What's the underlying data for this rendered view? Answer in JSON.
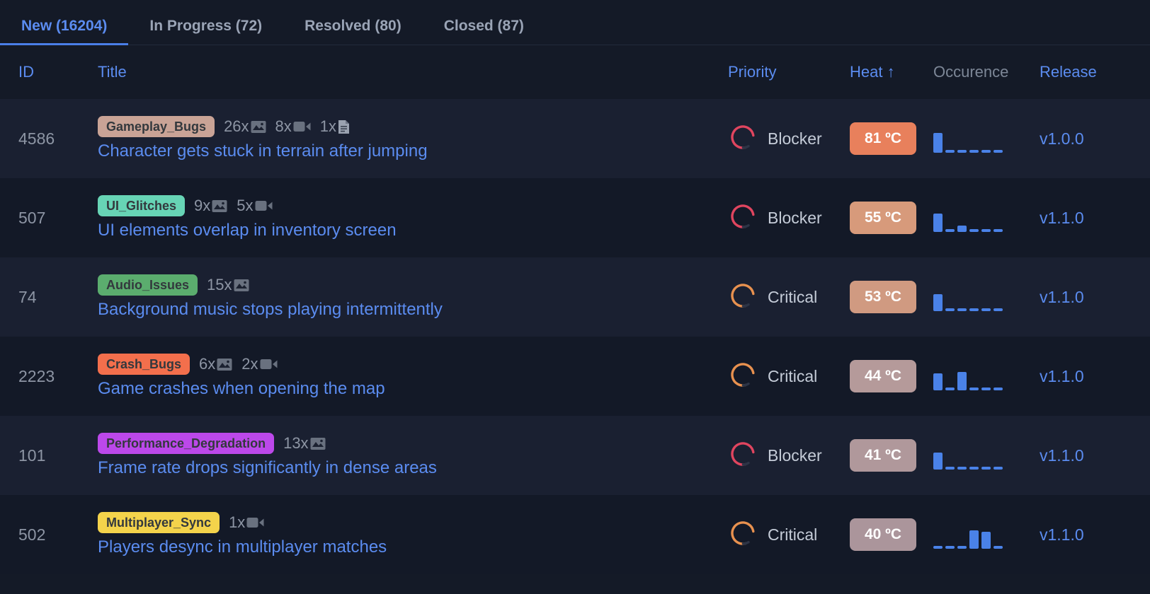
{
  "tabs": [
    {
      "label": "New (16204)",
      "active": true
    },
    {
      "label": "In Progress (72)",
      "active": false
    },
    {
      "label": "Resolved (80)",
      "active": false
    },
    {
      "label": "Closed (87)",
      "active": false
    }
  ],
  "columns": {
    "id": "ID",
    "title": "Title",
    "priority": "Priority",
    "heat": "Heat ↑",
    "occurence": "Occurence",
    "release": "Release"
  },
  "accent_color": "#5b8cf0",
  "rows": [
    {
      "id": "4586",
      "tag": "Gameplay_Bugs",
      "tag_color": "#c9a396",
      "attachments": [
        {
          "count": "26x",
          "icon": "image-icon"
        },
        {
          "count": "8x",
          "icon": "video-icon"
        },
        {
          "count": "1x",
          "icon": "document-icon"
        }
      ],
      "title": "Character gets stuck in terrain after jumping",
      "priority": "Blocker",
      "priority_color": "#e0455f",
      "heat": "81 ºC",
      "heat_color": "#e8805c",
      "occurence": [
        28,
        4,
        4,
        4,
        4,
        4
      ],
      "release": "v1.0.0"
    },
    {
      "id": "507",
      "tag": "UI_Glitches",
      "tag_color": "#67d4b5",
      "attachments": [
        {
          "count": "9x",
          "icon": "image-icon"
        },
        {
          "count": "5x",
          "icon": "video-icon"
        }
      ],
      "title": "UI elements overlap in inventory screen",
      "priority": "Blocker",
      "priority_color": "#e0455f",
      "heat": "55 ºC",
      "heat_color": "#d79a7b",
      "occurence": [
        26,
        4,
        9,
        4,
        4,
        4
      ],
      "release": "v1.1.0"
    },
    {
      "id": "74",
      "tag": "Audio_Issues",
      "tag_color": "#5bad6e",
      "attachments": [
        {
          "count": "15x",
          "icon": "image-icon"
        }
      ],
      "title": "Background music stops playing intermittently",
      "priority": "Critical",
      "priority_color": "#e8914f",
      "heat": "53 ºC",
      "heat_color": "#d09a81",
      "occurence": [
        24,
        4,
        4,
        4,
        4,
        4
      ],
      "release": "v1.1.0"
    },
    {
      "id": "2223",
      "tag": "Crash_Bugs",
      "tag_color": "#f36f4c",
      "attachments": [
        {
          "count": "6x",
          "icon": "image-icon"
        },
        {
          "count": "2x",
          "icon": "video-icon"
        }
      ],
      "title": "Game crashes when opening the map",
      "priority": "Critical",
      "priority_color": "#e8914f",
      "heat": "44 ºC",
      "heat_color": "#b59a9a",
      "occurence": [
        24,
        4,
        26,
        4,
        4,
        4
      ],
      "release": "v1.1.0"
    },
    {
      "id": "101",
      "tag": "Performance_Degradation",
      "tag_color": "#bc48ea",
      "attachments": [
        {
          "count": "13x",
          "icon": "image-icon"
        }
      ],
      "title": "Frame rate drops significantly in dense areas",
      "priority": "Blocker",
      "priority_color": "#e0455f",
      "heat": "41 ºC",
      "heat_color": "#b0989b",
      "occurence": [
        24,
        4,
        4,
        4,
        4,
        4
      ],
      "release": "v1.1.0"
    },
    {
      "id": "502",
      "tag": "Multiplayer_Sync",
      "tag_color": "#f4d34b",
      "attachments": [
        {
          "count": "1x",
          "icon": "video-icon"
        }
      ],
      "title": "Players desync in multiplayer matches",
      "priority": "Critical",
      "priority_color": "#e8914f",
      "heat": "40 ºC",
      "heat_color": "#ab959b",
      "occurence": [
        4,
        4,
        4,
        26,
        24,
        4
      ],
      "release": "v1.1.0"
    }
  ]
}
